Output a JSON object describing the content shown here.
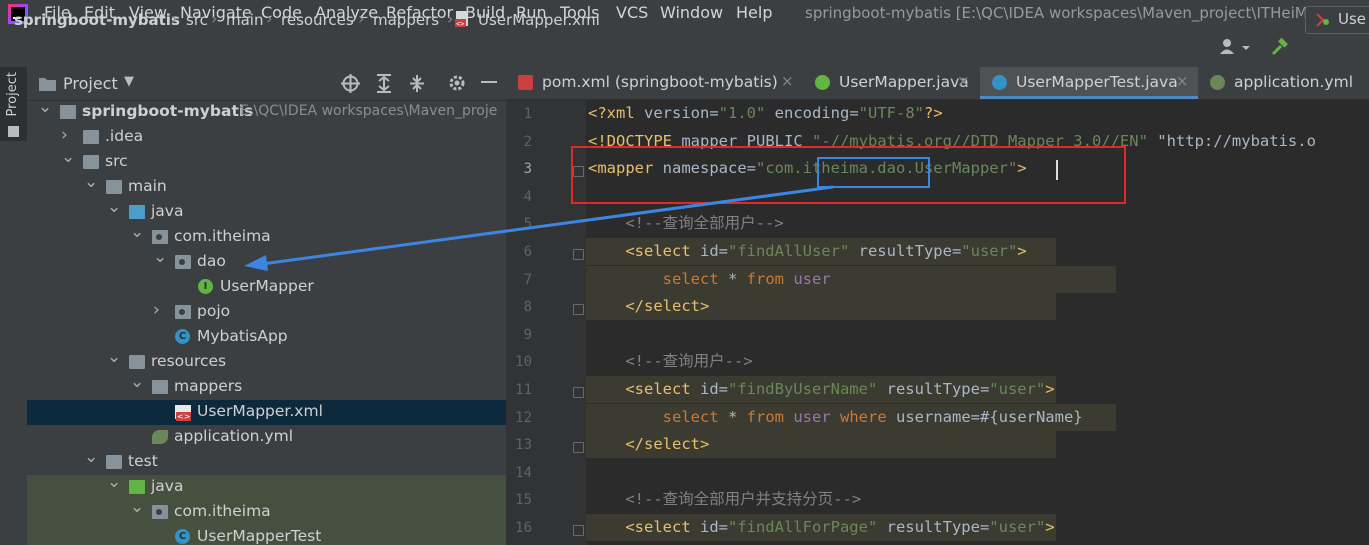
{
  "menu": [
    "File",
    "Edit",
    "View",
    "Navigate",
    "Code",
    "Analyze",
    "Refactor",
    "Build",
    "Run",
    "Tools",
    "VCS",
    "Window",
    "Help"
  ],
  "window_title": "springboot-mybatis [E:\\QC\\IDEA workspaces\\Maven_project\\ITHeiMa\\springb",
  "breadcrumb": [
    "springboot-mybatis",
    "src",
    "main",
    "resources",
    "mappers",
    "UserMapper.xml"
  ],
  "run_config_label": "Use",
  "stripe_label": "Project",
  "project_header": {
    "title": "Project"
  },
  "tree": [
    {
      "label": "springboot-mybatis",
      "extra": "E:\\QC\\IDEA workspaces\\Maven_proje",
      "depth": 0,
      "state": "open",
      "icon": "module-folder-icon"
    },
    {
      "label": ".idea",
      "depth": 1,
      "state": "closed",
      "icon": "folder-icon"
    },
    {
      "label": "src",
      "depth": 1,
      "state": "open",
      "icon": "folder-icon"
    },
    {
      "label": "main",
      "depth": 2,
      "state": "open",
      "icon": "folder-icon"
    },
    {
      "label": "java",
      "depth": 3,
      "state": "open",
      "icon": "source-folder-icon"
    },
    {
      "label": "com.itheima",
      "depth": 4,
      "state": "open",
      "icon": "package-icon"
    },
    {
      "label": "dao",
      "depth": 5,
      "state": "open",
      "icon": "package-icon"
    },
    {
      "label": "UserMapper",
      "depth": 6,
      "state": "leaf",
      "icon": "interface-icon"
    },
    {
      "label": "pojo",
      "depth": 5,
      "state": "closed",
      "icon": "package-icon"
    },
    {
      "label": "MybatisApp",
      "depth": 5,
      "state": "leaf",
      "icon": "spring-class-icon"
    },
    {
      "label": "resources",
      "depth": 3,
      "state": "open",
      "icon": "resources-folder-icon"
    },
    {
      "label": "mappers",
      "depth": 4,
      "state": "open",
      "icon": "folder-icon"
    },
    {
      "label": "UserMapper.xml",
      "depth": 5,
      "state": "leaf",
      "icon": "xml-file-icon",
      "selected": true
    },
    {
      "label": "application.yml",
      "depth": 4,
      "state": "leaf",
      "icon": "yml-file-icon"
    },
    {
      "label": "test",
      "depth": 2,
      "state": "open",
      "icon": "folder-icon"
    },
    {
      "label": "java",
      "depth": 3,
      "state": "open",
      "icon": "test-source-folder-icon"
    },
    {
      "label": "com.itheima",
      "depth": 4,
      "state": "open",
      "icon": "package-icon"
    },
    {
      "label": "UserMapperTest",
      "depth": 5,
      "state": "leaf",
      "icon": "test-class-icon"
    }
  ],
  "tabs": [
    {
      "label": "pom.xml (springboot-mybatis)",
      "icon": "maven-icon"
    },
    {
      "label": "UserMapper.java",
      "icon": "interface-icon"
    },
    {
      "label": "UserMapperTest.java",
      "icon": "test-class-icon",
      "active": true
    },
    {
      "label": "application.yml",
      "icon": "yml-file-icon"
    }
  ],
  "code_lines": [
    "<?xml version=\"1.0\" encoding=\"UTF-8\"?>",
    "<!DOCTYPE mapper PUBLIC \"-//mybatis.org//DTD Mapper 3.0//EN\" \"http://mybatis.o",
    "<mapper namespace=\"com.itheima.dao.UserMapper\">",
    "",
    "    <!--查询全部用户-->",
    "    <select id=\"findAllUser\" resultType=\"user\">",
    "        select * from user",
    "    </select>",
    "",
    "    <!--查询用户-->",
    "    <select id=\"findByUserName\" resultType=\"user\">",
    "        select * from user where username=#{userName}",
    "    </select>",
    "",
    "    <!--查询全部用户并支持分页-->",
    "    <select id=\"findAllForPage\" resultType=\"user\">"
  ]
}
